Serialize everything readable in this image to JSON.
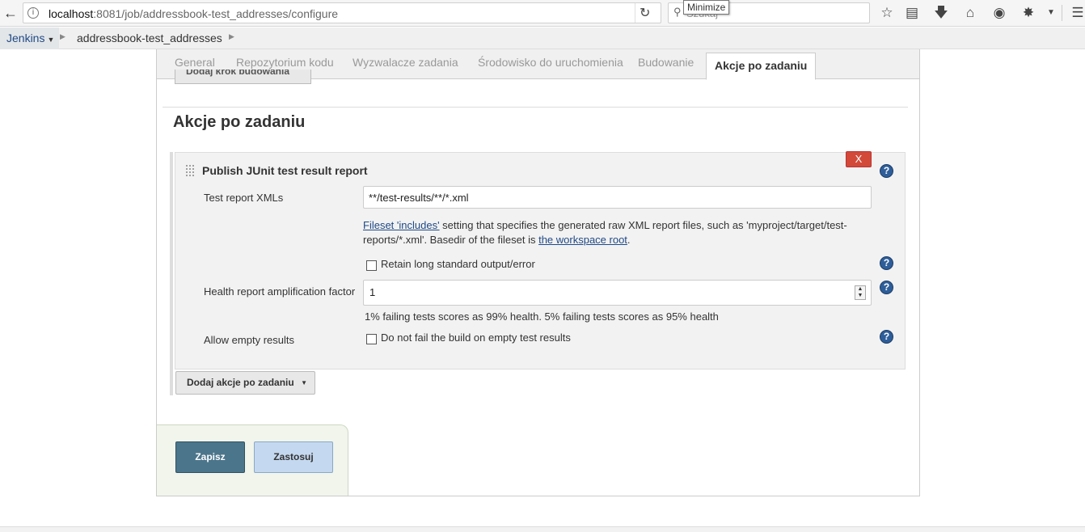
{
  "browser": {
    "url_host": "localhost",
    "url_rest": ":8081/job/addressbook-test_addresses/configure",
    "search_placeholder": "Szukaj",
    "tooltip": "Minimize"
  },
  "breadcrumb": {
    "root": "Jenkins",
    "job": "addressbook-test_addresses"
  },
  "tabs": [
    {
      "label": "General"
    },
    {
      "label": "Repozytorium kodu"
    },
    {
      "label": "Wyzwalacze zadania"
    },
    {
      "label": "Środowisko do uruchomienia"
    },
    {
      "label": "Budowanie"
    },
    {
      "label": "Akcje po zadaniu"
    }
  ],
  "active_tab": "Akcje po zadaniu",
  "prev_section_button": "Dodaj krok budowania",
  "section_title": "Akcje po zadaniu",
  "junit": {
    "title": "Publish JUnit test result report",
    "delete_label": "X",
    "test_report_label": "Test report XMLs",
    "test_report_value": "**/test-results/**/*.xml",
    "desc_link1": "Fileset 'includes'",
    "desc_text1": " setting that specifies the generated raw XML report files, such as 'myproject/target/test-reports/*.xml'. Basedir of the fileset is ",
    "desc_link2": "the workspace root",
    "desc_text2": ".",
    "retain_label": "Retain long standard output/error",
    "retain_checked": false,
    "health_label": "Health report amplification factor",
    "health_value": "1",
    "health_note": "1% failing tests scores as 99% health. 5% failing tests scores as 95% health",
    "allow_empty_label": "Allow empty results",
    "allow_empty_cb_label": "Do not fail the build on empty test results",
    "allow_empty_checked": false
  },
  "add_post_build_button": "Dodaj akcje po zadaniu",
  "buttons": {
    "save": "Zapisz",
    "apply": "Zastosuj"
  },
  "help_glyph": "?",
  "colors": {
    "save_button": "#4b758b",
    "apply_button": "#c4d8ef",
    "delete_button": "#d24939",
    "help_icon": "#2e5e9a",
    "link": "#204a87"
  }
}
